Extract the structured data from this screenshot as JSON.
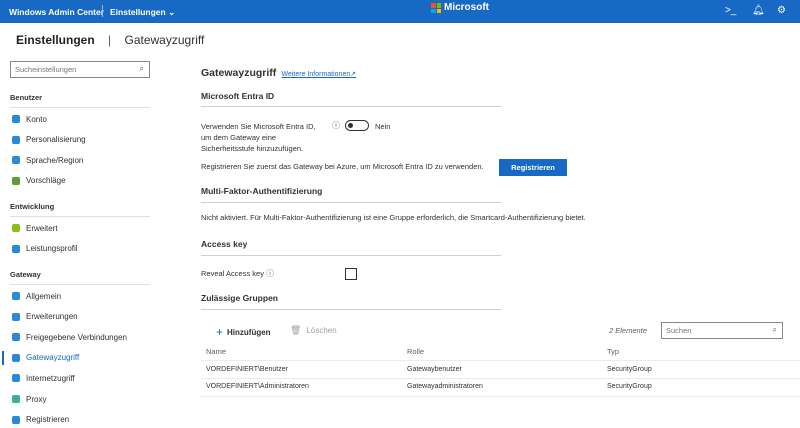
{
  "header": {
    "app_name": "Windows Admin Center",
    "context": "Einstellungen",
    "brand": "Microsoft",
    "icons": [
      "terminal-icon",
      "bell-icon",
      "gear-icon"
    ]
  },
  "breadcrumb": {
    "root": "Einstellungen",
    "current": "Gatewayzugriff"
  },
  "sidebar": {
    "search_placeholder": "Sucheinstellungen",
    "sections": [
      {
        "title": "Benutzer",
        "items": [
          {
            "label": "Konto",
            "icon": "person-icon",
            "color": "#2b88d8"
          },
          {
            "label": "Personalisierung",
            "icon": "palette-icon",
            "color": "#2b88d8"
          },
          {
            "label": "Sprache/Region",
            "icon": "globe-gear-icon",
            "color": "#2b88d8"
          },
          {
            "label": "Vorschläge",
            "icon": "lightbulb-icon",
            "color": "#5c9e31"
          }
        ]
      },
      {
        "title": "Entwicklung",
        "items": [
          {
            "label": "Erweitert",
            "icon": "advanced-icon",
            "color": "#8cbd18"
          },
          {
            "label": "Leistungsprofil",
            "icon": "chart-icon",
            "color": "#2b88d8"
          }
        ]
      },
      {
        "title": "Gateway",
        "items": [
          {
            "label": "Allgemein",
            "icon": "gear-icon",
            "color": "#2b88d8"
          },
          {
            "label": "Erweiterungen",
            "icon": "extension-icon",
            "color": "#2b88d8"
          },
          {
            "label": "Freigegebene Verbindungen",
            "icon": "shared-connections-icon",
            "color": "#2b88d8"
          },
          {
            "label": "Gatewayzugriff",
            "icon": "people-icon",
            "color": "#2b88d8",
            "selected": true
          },
          {
            "label": "Internetzugriff",
            "icon": "globe-icon",
            "color": "#2b88d8"
          },
          {
            "label": "Proxy",
            "icon": "proxy-icon",
            "color": "#3ab0a0"
          },
          {
            "label": "Registrieren",
            "icon": "cloud-icon",
            "color": "#2b88d8"
          }
        ]
      }
    ]
  },
  "main": {
    "title": "Gatewayzugriff",
    "more_info": "Weitere Informationen",
    "entra": {
      "heading": "Microsoft Entra ID",
      "toggle_label_lines": [
        "Verwenden Sie Microsoft Entra ID,",
        "um dem Gateway eine",
        "Sicherheitsstufe hinzuzufügen."
      ],
      "toggle_state": "Nein",
      "register_text": "Registrieren Sie zuerst das Gateway bei Azure, um Microsoft Entra ID zu verwenden.",
      "register_button": "Registrieren"
    },
    "mfa": {
      "heading": "Multi-Faktor-Authentifizierung",
      "text": "Nicht aktiviert. Für Multi-Faktor-Authentifizierung ist eine Gruppe erforderlich, die Smartcard-Authentifizierung bietet."
    },
    "access_key": {
      "heading": "Access key",
      "reveal_label": "Reveal Access key"
    },
    "groups": {
      "heading": "Zulässige Gruppen",
      "add": "Hinzufügen",
      "delete": "Löschen",
      "count": "2 Elemente",
      "search_placeholder": "Suchen",
      "columns": [
        "Name",
        "Rolle",
        "Typ"
      ],
      "rows": [
        [
          "VORDEFINIERT\\Benutzer",
          "Gatewaybenutzer",
          "SecurityGroup"
        ],
        [
          "VORDEFINIERT\\Administratoren",
          "Gatewayadministratoren",
          "SecurityGroup"
        ]
      ]
    }
  },
  "colors": {
    "accent": "#1769c4"
  }
}
